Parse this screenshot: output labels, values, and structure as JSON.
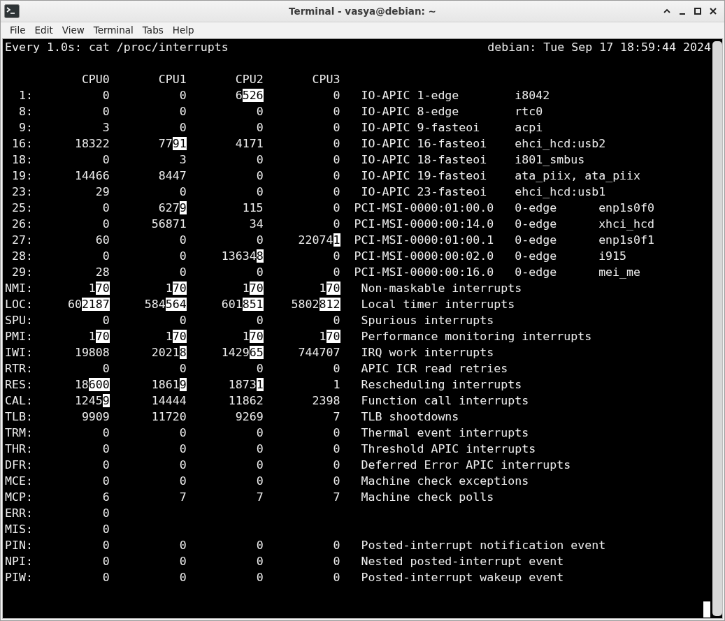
{
  "window": {
    "title": "Terminal - vasya@debian: ~"
  },
  "menu": [
    "File",
    "Edit",
    "View",
    "Terminal",
    "Tabs",
    "Help"
  ],
  "terminal": {
    "command_line": "Every 1.0s: cat /proc/interrupts",
    "status": "debian: Tue Sep 17 18:59:44 2024",
    "columns": [
      "CPU0",
      "CPU1",
      "CPU2",
      "CPU3"
    ],
    "rows": [
      {
        "label": "1:",
        "kind": "io-apic",
        "counts": [
          {
            "text": "0"
          },
          {
            "text": "0"
          },
          {
            "text": "6",
            "changed": "526"
          },
          {
            "text": "0"
          }
        ],
        "fields": [
          "IO-APIC",
          "1-edge",
          "i8042"
        ]
      },
      {
        "label": "8:",
        "kind": "io-apic",
        "counts": [
          {
            "text": "0"
          },
          {
            "text": "0"
          },
          {
            "text": "0"
          },
          {
            "text": "0"
          }
        ],
        "fields": [
          "IO-APIC",
          "8-edge",
          "rtc0"
        ]
      },
      {
        "label": "9:",
        "kind": "io-apic",
        "counts": [
          {
            "text": "3"
          },
          {
            "text": "0"
          },
          {
            "text": "0"
          },
          {
            "text": "0"
          }
        ],
        "fields": [
          "IO-APIC",
          "9-fasteoi",
          "acpi"
        ]
      },
      {
        "label": "16:",
        "kind": "io-apic",
        "counts": [
          {
            "text": "18322"
          },
          {
            "text": "77",
            "changed": "91"
          },
          {
            "text": "4171"
          },
          {
            "text": "0"
          }
        ],
        "fields": [
          "IO-APIC",
          "16-fasteoi",
          "ehci_hcd:usb2"
        ]
      },
      {
        "label": "18:",
        "kind": "io-apic",
        "counts": [
          {
            "text": "0"
          },
          {
            "text": "3"
          },
          {
            "text": "0"
          },
          {
            "text": "0"
          }
        ],
        "fields": [
          "IO-APIC",
          "18-fasteoi",
          "i801_smbus"
        ]
      },
      {
        "label": "19:",
        "kind": "io-apic",
        "counts": [
          {
            "text": "14466"
          },
          {
            "text": "8447"
          },
          {
            "text": "0"
          },
          {
            "text": "0"
          }
        ],
        "fields": [
          "IO-APIC",
          "19-fasteoi",
          "ata_piix, ata_piix"
        ]
      },
      {
        "label": "23:",
        "kind": "io-apic",
        "counts": [
          {
            "text": "29"
          },
          {
            "text": "0"
          },
          {
            "text": "0"
          },
          {
            "text": "0"
          }
        ],
        "fields": [
          "IO-APIC",
          "23-fasteoi",
          "ehci_hcd:usb1"
        ]
      },
      {
        "label": "25:",
        "kind": "pci-msi",
        "counts": [
          {
            "text": "0"
          },
          {
            "text": "627",
            "changed": "9"
          },
          {
            "text": "115"
          },
          {
            "text": "0"
          }
        ],
        "fields": [
          "PCI-MSI-0000:01:00.0",
          "0-edge",
          "enp1s0f0"
        ]
      },
      {
        "label": "26:",
        "kind": "pci-msi",
        "counts": [
          {
            "text": "0"
          },
          {
            "text": "56871"
          },
          {
            "text": "34"
          },
          {
            "text": "0"
          }
        ],
        "fields": [
          "PCI-MSI-0000:00:14.0",
          "0-edge",
          "xhci_hcd"
        ]
      },
      {
        "label": "27:",
        "kind": "pci-msi",
        "counts": [
          {
            "text": "60"
          },
          {
            "text": "0"
          },
          {
            "text": "0"
          },
          {
            "text": "22074",
            "changed": "1"
          }
        ],
        "fields": [
          "PCI-MSI-0000:01:00.1",
          "0-edge",
          "enp1s0f1"
        ]
      },
      {
        "label": "28:",
        "kind": "pci-msi",
        "counts": [
          {
            "text": "0"
          },
          {
            "text": "0"
          },
          {
            "text": "13634",
            "changed": "8"
          },
          {
            "text": "0"
          }
        ],
        "fields": [
          "PCI-MSI-0000:00:02.0",
          "0-edge",
          "i915"
        ]
      },
      {
        "label": "29:",
        "kind": "pci-msi",
        "counts": [
          {
            "text": "28"
          },
          {
            "text": "0"
          },
          {
            "text": "0"
          },
          {
            "text": "0"
          }
        ],
        "fields": [
          "PCI-MSI-0000:00:16.0",
          "0-edge",
          "mei_me"
        ]
      },
      {
        "label": "NMI:",
        "kind": "summary",
        "counts": [
          {
            "text": "1",
            "changed": "70"
          },
          {
            "text": "1",
            "changed": "70"
          },
          {
            "text": "1",
            "changed": "70"
          },
          {
            "text": "1",
            "changed": "70"
          }
        ],
        "fields": [
          "Non-maskable interrupts"
        ]
      },
      {
        "label": "LOC:",
        "kind": "summary",
        "counts": [
          {
            "text": "60",
            "changed": "2187"
          },
          {
            "text": "584",
            "changed": "564"
          },
          {
            "text": "601",
            "changed": "851"
          },
          {
            "text": "5802",
            "changed": "812"
          }
        ],
        "fields": [
          "Local timer interrupts"
        ]
      },
      {
        "label": "SPU:",
        "kind": "summary",
        "counts": [
          {
            "text": "0"
          },
          {
            "text": "0"
          },
          {
            "text": "0"
          },
          {
            "text": "0"
          }
        ],
        "fields": [
          "Spurious interrupts"
        ]
      },
      {
        "label": "PMI:",
        "kind": "summary",
        "counts": [
          {
            "text": "1",
            "changed": "70"
          },
          {
            "text": "1",
            "changed": "70"
          },
          {
            "text": "1",
            "changed": "70"
          },
          {
            "text": "1",
            "changed": "70"
          }
        ],
        "fields": [
          "Performance monitoring interrupts"
        ]
      },
      {
        "label": "IWI:",
        "kind": "summary",
        "counts": [
          {
            "text": "19808"
          },
          {
            "text": "2021",
            "changed": "8"
          },
          {
            "text": "1429",
            "changed": "65"
          },
          {
            "text": "744707"
          }
        ],
        "fields": [
          "IRQ work interrupts"
        ]
      },
      {
        "label": "RTR:",
        "kind": "summary",
        "counts": [
          {
            "text": "0"
          },
          {
            "text": "0"
          },
          {
            "text": "0"
          },
          {
            "text": "0"
          }
        ],
        "fields": [
          "APIC ICR read retries"
        ]
      },
      {
        "label": "RES:",
        "kind": "summary",
        "counts": [
          {
            "text": "18",
            "changed": "600"
          },
          {
            "text": "1861",
            "changed": "9"
          },
          {
            "text": "1873",
            "changed": "1"
          },
          {
            "text": "1"
          }
        ],
        "fields": [
          "Rescheduling interrupts"
        ]
      },
      {
        "label": "CAL:",
        "kind": "summary",
        "counts": [
          {
            "text": "1245",
            "changed": "9"
          },
          {
            "text": "14444"
          },
          {
            "text": "11862"
          },
          {
            "text": "2398"
          }
        ],
        "fields": [
          "Function call interrupts"
        ]
      },
      {
        "label": "TLB:",
        "kind": "summary",
        "counts": [
          {
            "text": "9909"
          },
          {
            "text": "11720"
          },
          {
            "text": "9269"
          },
          {
            "text": "7"
          }
        ],
        "fields": [
          "TLB shootdowns"
        ]
      },
      {
        "label": "TRM:",
        "kind": "summary",
        "counts": [
          {
            "text": "0"
          },
          {
            "text": "0"
          },
          {
            "text": "0"
          },
          {
            "text": "0"
          }
        ],
        "fields": [
          "Thermal event interrupts"
        ]
      },
      {
        "label": "THR:",
        "kind": "summary",
        "counts": [
          {
            "text": "0"
          },
          {
            "text": "0"
          },
          {
            "text": "0"
          },
          {
            "text": "0"
          }
        ],
        "fields": [
          "Threshold APIC interrupts"
        ]
      },
      {
        "label": "DFR:",
        "kind": "summary",
        "counts": [
          {
            "text": "0"
          },
          {
            "text": "0"
          },
          {
            "text": "0"
          },
          {
            "text": "0"
          }
        ],
        "fields": [
          "Deferred Error APIC interrupts"
        ]
      },
      {
        "label": "MCE:",
        "kind": "summary",
        "counts": [
          {
            "text": "0"
          },
          {
            "text": "0"
          },
          {
            "text": "0"
          },
          {
            "text": "0"
          }
        ],
        "fields": [
          "Machine check exceptions"
        ]
      },
      {
        "label": "MCP:",
        "kind": "summary",
        "counts": [
          {
            "text": "6"
          },
          {
            "text": "7"
          },
          {
            "text": "7"
          },
          {
            "text": "7"
          }
        ],
        "fields": [
          "Machine check polls"
        ]
      },
      {
        "label": "ERR:",
        "kind": "summary",
        "counts": [
          {
            "text": "0"
          }
        ],
        "fields": []
      },
      {
        "label": "MIS:",
        "kind": "summary",
        "counts": [
          {
            "text": "0"
          }
        ],
        "fields": []
      },
      {
        "label": "PIN:",
        "kind": "summary",
        "counts": [
          {
            "text": "0"
          },
          {
            "text": "0"
          },
          {
            "text": "0"
          },
          {
            "text": "0"
          }
        ],
        "fields": [
          "Posted-interrupt notification event"
        ]
      },
      {
        "label": "NPI:",
        "kind": "summary",
        "counts": [
          {
            "text": "0"
          },
          {
            "text": "0"
          },
          {
            "text": "0"
          },
          {
            "text": "0"
          }
        ],
        "fields": [
          "Nested posted-interrupt event"
        ]
      },
      {
        "label": "PIW:",
        "kind": "summary",
        "counts": [
          {
            "text": "0"
          },
          {
            "text": "0"
          },
          {
            "text": "0"
          },
          {
            "text": "0"
          }
        ],
        "fields": [
          "Posted-interrupt wakeup event"
        ]
      }
    ]
  }
}
